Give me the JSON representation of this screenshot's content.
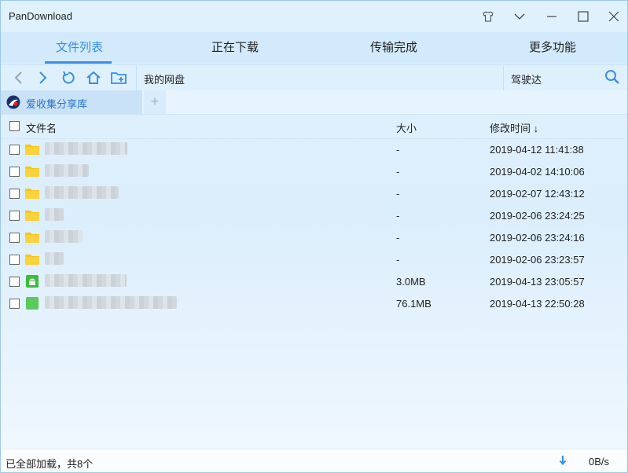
{
  "window": {
    "title": "PanDownload"
  },
  "titlebar": {
    "icons": [
      "shirt-icon",
      "chevron-down-icon",
      "minimize-icon",
      "maximize-icon",
      "close-icon"
    ]
  },
  "tabs": [
    {
      "label": "文件列表",
      "active": true
    },
    {
      "label": "正在下载",
      "active": false
    },
    {
      "label": "传输完成",
      "active": false
    },
    {
      "label": "更多功能",
      "active": false
    }
  ],
  "toolbar": {
    "path": "我的网盘",
    "search_value": "驾驶达",
    "icons": [
      "back-icon",
      "forward-icon",
      "refresh-icon",
      "home-icon",
      "new-folder-icon",
      "search-icon"
    ]
  },
  "share": {
    "tab_label": "爱收集分享库",
    "add_label": "+"
  },
  "columns": {
    "name": "文件名",
    "size": "大小",
    "modified": "修改时间 ↓"
  },
  "files": [
    {
      "type": "folder",
      "size": "-",
      "modified": "2019-04-12 11:41:38"
    },
    {
      "type": "folder",
      "size": "-",
      "modified": "2019-04-02 14:10:06"
    },
    {
      "type": "folder",
      "size": "-",
      "modified": "2019-02-07 12:43:12"
    },
    {
      "type": "folder",
      "size": "-",
      "modified": "2019-02-06 23:24:25"
    },
    {
      "type": "folder",
      "size": "-",
      "modified": "2019-02-06 23:24:16"
    },
    {
      "type": "folder",
      "size": "-",
      "modified": "2019-02-06 23:23:57"
    },
    {
      "type": "apk",
      "size": "3.0MB",
      "modified": "2019-04-13 23:05:57"
    },
    {
      "type": "file",
      "size": "76.1MB",
      "modified": "2019-04-13 22:50:28"
    }
  ],
  "status": {
    "text": "已全部加载，共8个",
    "speed": "0B/s"
  },
  "colors": {
    "accent": "#3a8ee0",
    "folder": "#f5c518",
    "apk": "#3dbb3d"
  }
}
